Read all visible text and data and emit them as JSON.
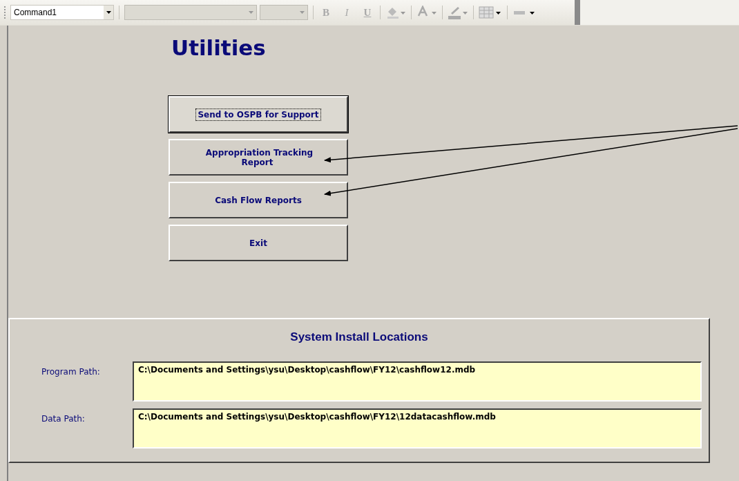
{
  "toolbar": {
    "object_box": "Command1",
    "tools": [
      {
        "kind": "bold",
        "label": "B",
        "disabled": true
      },
      {
        "kind": "italic",
        "label": "I",
        "disabled": true
      },
      {
        "kind": "underline",
        "label": "U",
        "disabled": true
      }
    ]
  },
  "form": {
    "title": "Utilities",
    "buttons": [
      {
        "label": "Send to OSPB for Support",
        "focused": true
      },
      {
        "label": "Appropriation Tracking Report",
        "focused": false
      },
      {
        "label": "Cash Flow Reports",
        "focused": false
      },
      {
        "label": "Exit",
        "focused": false
      }
    ],
    "install_panel": {
      "title": "System Install Locations",
      "fields": [
        {
          "label": "Program Path:",
          "value": "C:\\Documents and Settings\\ysu\\Desktop\\cashflow\\FY12\\cashflow12.mdb"
        },
        {
          "label": "Data Path:",
          "value": "C:\\Documents and Settings\\ysu\\Desktop\\cashflow\\FY12\\12datacashflow.mdb"
        }
      ]
    }
  }
}
